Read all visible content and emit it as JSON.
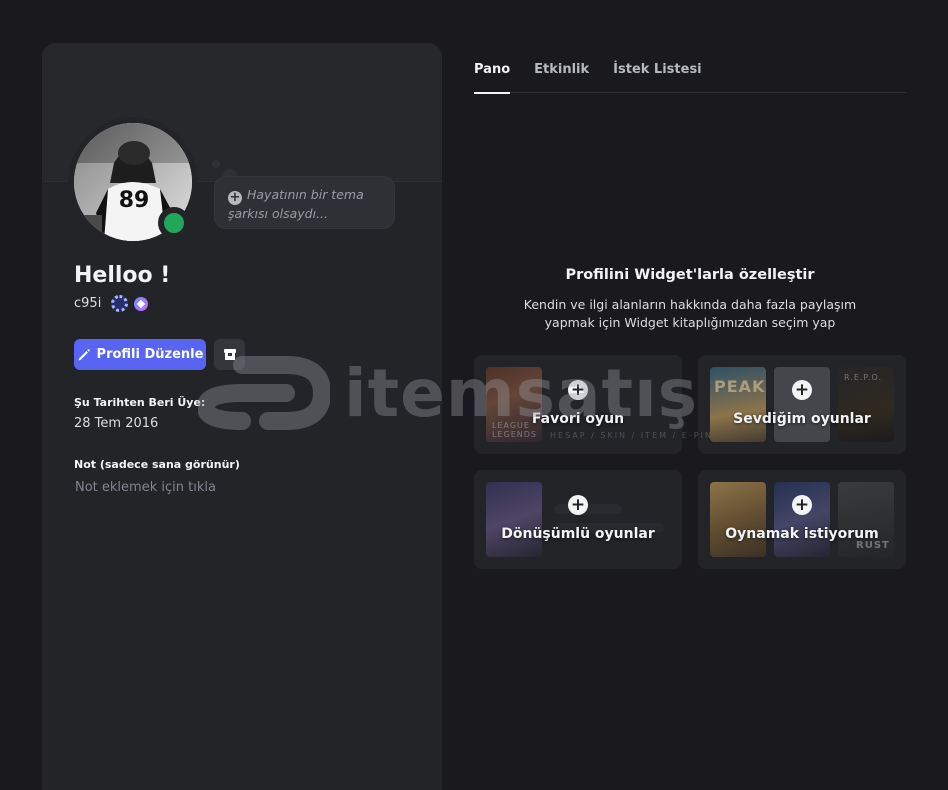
{
  "profile": {
    "song_placeholder": "Hayatının bir tema şarkısı olsaydı...",
    "display_name": "Helloo !",
    "username": "c95i",
    "edit_button": "Profili Düzenle",
    "member_since_label": "Şu Tarihten Beri Üye:",
    "member_since_value": "28 Tem 2016",
    "note_label": "Not (sadece sana görünür)",
    "note_placeholder": "Not eklemek için tıkla",
    "avatar_jersey": "89"
  },
  "tabs": [
    {
      "label": "Pano",
      "active": true
    },
    {
      "label": "Etkinlik",
      "active": false
    },
    {
      "label": "İstek Listesi",
      "active": false
    }
  ],
  "widgets": {
    "title": "Profilini Widget'larla özelleştir",
    "description_line1": "Kendin ve ilgi alanların hakkında daha fazla paylaşım",
    "description_line2": "yapmak için Widget kitaplığımızdan seçim yap",
    "cards": [
      {
        "label": "Favori oyun",
        "thumb_text": "LEAGUE LEGENDS"
      },
      {
        "label": "Sevdiğim oyunlar",
        "thumb_text_1": "PEAK",
        "thumb_text_2": "R.E.P.O."
      },
      {
        "label": "Dönüşümlü oyunlar"
      },
      {
        "label": "Oynamak istiyorum",
        "thumb_text": "RUST"
      }
    ]
  },
  "watermark": {
    "text": "itemsatış",
    "subtext": "HESAP / SKIN / ITEM / E-PIN"
  },
  "colors": {
    "background": "#1a1a1e",
    "card": "#232428",
    "accent": "#5865f2",
    "online": "#23a55a"
  }
}
